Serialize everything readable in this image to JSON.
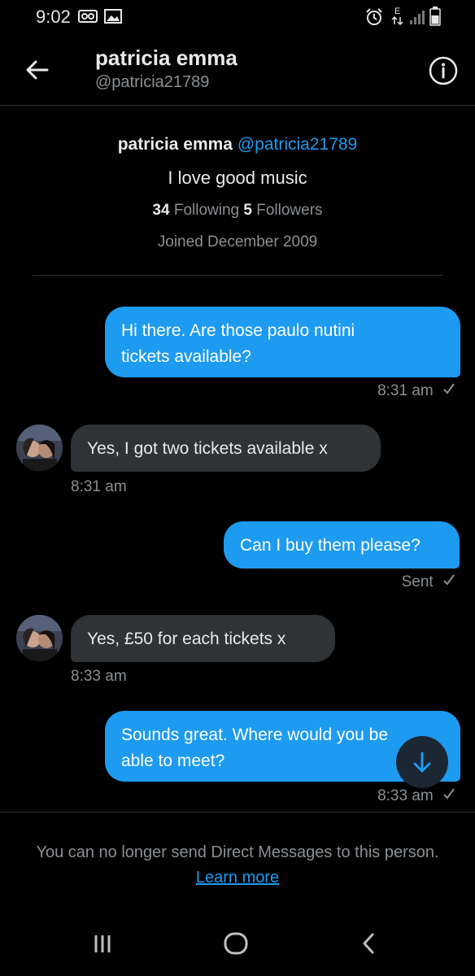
{
  "status_bar": {
    "time": "9:02",
    "icons": [
      "voicemail-icon",
      "gallery-icon",
      "alarm-icon",
      "data-e-icon",
      "signal-icon",
      "battery-icon"
    ]
  },
  "header": {
    "name": "patricia emma",
    "handle": "@patricia21789",
    "back_icon": "arrow-left-icon",
    "info_icon": "info-icon"
  },
  "profile": {
    "name": "patricia emma",
    "handle": "@patricia21789",
    "bio": "I love good music",
    "following_count": "34",
    "following_label": "Following",
    "followers_count": "5",
    "followers_label": "Followers",
    "joined": "Joined December 2009"
  },
  "messages": [
    {
      "direction": "out",
      "lines": [
        "Hi there. Are those paulo nutini",
        "tickets available?"
      ],
      "meta": "8:31 am",
      "read": true
    },
    {
      "direction": "in",
      "lines": [
        "Yes, I got two tickets available x"
      ],
      "meta": "8:31 am"
    },
    {
      "direction": "out",
      "lines": [
        "Can I buy them please?"
      ],
      "meta": "Sent",
      "read": true
    },
    {
      "direction": "in",
      "lines": [
        "Yes, £50 for each tickets x"
      ],
      "meta": "8:33 am"
    },
    {
      "direction": "out",
      "lines": [
        "Sounds great. Where would you be",
        "able to meet?"
      ],
      "meta": "8:33 am",
      "read": true
    }
  ],
  "notice": {
    "text": "You can no longer send Direct Messages to this person.",
    "link": "Learn more"
  },
  "colors": {
    "accent": "#1d9bf0",
    "background": "#000000",
    "incoming_bubble": "#2f3336",
    "muted_text": "#8b8f93"
  }
}
